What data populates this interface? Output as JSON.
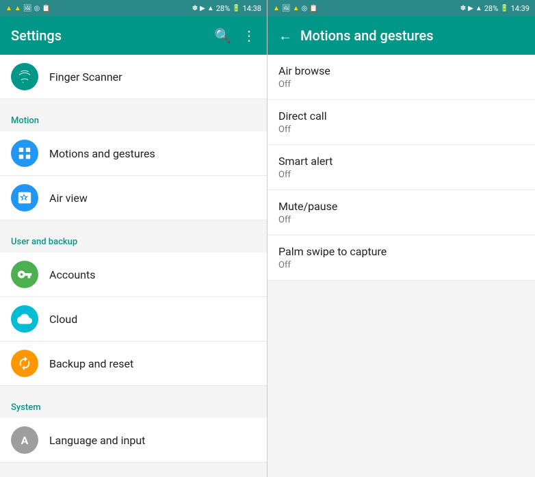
{
  "left": {
    "status_bar": {
      "left_icons": "▲ ▲ 🖼 ◉ 📋",
      "time": "14:38",
      "right_icons": "⚡ ▶ ⬆ 28% 🔋"
    },
    "app_bar": {
      "title": "Settings",
      "search_icon": "🔍",
      "more_icon": "⋮"
    },
    "items": [
      {
        "id": "finger-scanner",
        "icon": "👆",
        "icon_color": "icon-teal",
        "title": "Finger Scanner",
        "subtitle": ""
      }
    ],
    "sections": [
      {
        "id": "motion",
        "label": "Motion",
        "items": [
          {
            "id": "motions-gestures",
            "icon": "⬜",
            "icon_color": "icon-blue",
            "title": "Motions and gestures",
            "subtitle": ""
          },
          {
            "id": "air-view",
            "icon": "☝",
            "icon_color": "icon-blue",
            "title": "Air view",
            "subtitle": ""
          }
        ]
      },
      {
        "id": "user-backup",
        "label": "User and backup",
        "items": [
          {
            "id": "accounts",
            "icon": "🔑",
            "icon_color": "icon-green",
            "title": "Accounts",
            "subtitle": ""
          },
          {
            "id": "cloud",
            "icon": "☁",
            "icon_color": "icon-cyan",
            "title": "Cloud",
            "subtitle": ""
          },
          {
            "id": "backup-reset",
            "icon": "↺",
            "icon_color": "icon-orange",
            "title": "Backup and reset",
            "subtitle": ""
          }
        ]
      },
      {
        "id": "system",
        "label": "System",
        "items": [
          {
            "id": "language-input",
            "icon": "A",
            "icon_color": "icon-gray",
            "title": "Language and input",
            "subtitle": ""
          }
        ]
      }
    ]
  },
  "right": {
    "status_bar": {
      "left_icons": "▲ 🖼 ▲ ◉ 📋",
      "time": "14:39",
      "right_icons": "⚡ ▶ ⬆ 28% 🔋"
    },
    "app_bar": {
      "back_label": "←",
      "title": "Motions and gestures"
    },
    "items": [
      {
        "id": "air-browse",
        "title": "Air browse",
        "status": "Off"
      },
      {
        "id": "direct-call",
        "title": "Direct call",
        "status": "Off"
      },
      {
        "id": "smart-alert",
        "title": "Smart alert",
        "status": "Off"
      },
      {
        "id": "mute-pause",
        "title": "Mute/pause",
        "status": "Off"
      },
      {
        "id": "palm-swipe",
        "title": "Palm swipe to capture",
        "status": "Off"
      }
    ]
  },
  "icons": {
    "finger_scanner": "fingerprint",
    "motions_gestures": "vibration",
    "air_view": "touch",
    "accounts": "key",
    "cloud": "cloud",
    "backup_reset": "refresh",
    "language_input": "A"
  }
}
